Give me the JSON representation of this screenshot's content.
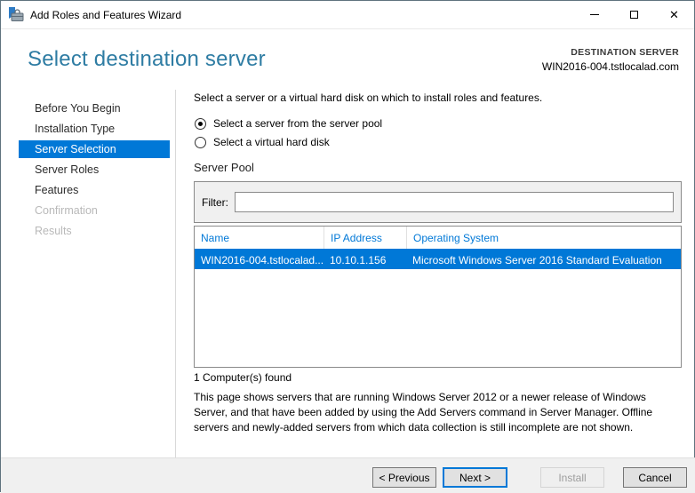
{
  "window": {
    "title": "Add Roles and Features Wizard"
  },
  "header": {
    "title": "Select destination server",
    "destination_label": "DESTINATION SERVER",
    "destination_server": "WIN2016-004.tstlocalad.com"
  },
  "sidebar": {
    "items": [
      {
        "label": "Before You Begin",
        "state": "normal"
      },
      {
        "label": "Installation Type",
        "state": "normal"
      },
      {
        "label": "Server Selection",
        "state": "selected"
      },
      {
        "label": "Server Roles",
        "state": "normal"
      },
      {
        "label": "Features",
        "state": "normal"
      },
      {
        "label": "Confirmation",
        "state": "disabled"
      },
      {
        "label": "Results",
        "state": "disabled"
      }
    ]
  },
  "main": {
    "description": "Select a server or a virtual hard disk on which to install roles and features.",
    "radios": [
      {
        "label": "Select a server from the server pool",
        "selected": true
      },
      {
        "label": "Select a virtual hard disk",
        "selected": false
      }
    ],
    "server_pool": {
      "label": "Server Pool",
      "filter_label": "Filter:",
      "filter_value": "",
      "table": {
        "columns": [
          "Name",
          "IP Address",
          "Operating System"
        ],
        "rows": [
          {
            "name": "WIN2016-004.tstlocalad....",
            "ip": "10.10.1.156",
            "os": "Microsoft Windows Server 2016 Standard Evaluation",
            "selected": true
          }
        ]
      },
      "count_text": "1 Computer(s) found"
    },
    "note": "This page shows servers that are running Windows Server 2012 or a newer release of Windows Server, and that have been added by using the Add Servers command in Server Manager. Offline servers and newly-added servers from which data collection is still incomplete are not shown."
  },
  "footer": {
    "buttons": [
      {
        "label": "< Previous",
        "enabled": true
      },
      {
        "label": "Next >",
        "enabled": true,
        "default": true
      },
      {
        "label": "Install",
        "enabled": false
      },
      {
        "label": "Cancel",
        "enabled": true
      }
    ]
  },
  "colors": {
    "accent": "#0078d7",
    "heading": "#2e7ca3",
    "selected_row_bg": "#0078d7",
    "footer_bg": "#f0f0f0"
  }
}
